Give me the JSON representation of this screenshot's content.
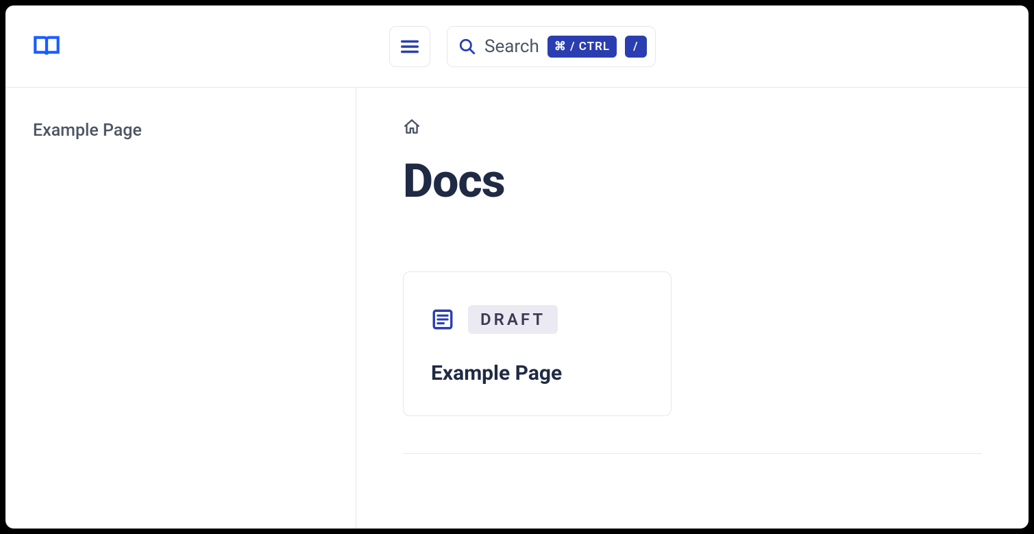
{
  "header": {
    "search_placeholder": "Search",
    "kbd_combo": "⌘ / CTRL",
    "kbd_slash": "/"
  },
  "sidebar": {
    "items": [
      {
        "label": "Example Page"
      }
    ]
  },
  "main": {
    "title": "Docs",
    "cards": [
      {
        "badge": "DRAFT",
        "title": "Example Page"
      }
    ]
  }
}
